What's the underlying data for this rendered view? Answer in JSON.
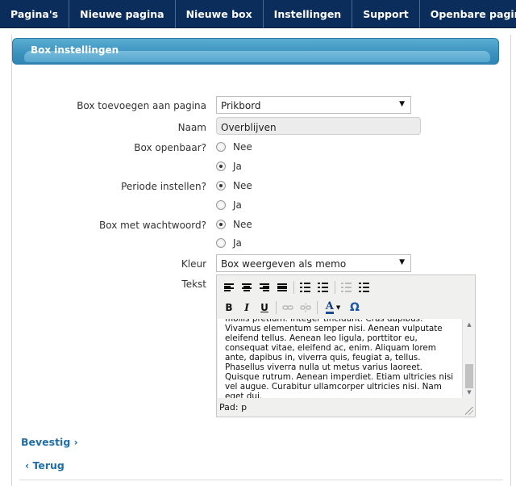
{
  "nav": {
    "items": [
      "Pagina's",
      "Nieuwe pagina",
      "Nieuwe box",
      "Instellingen",
      "Support",
      "Openbare pagina"
    ]
  },
  "panel": {
    "title": "Box instellingen"
  },
  "form": {
    "page_label": "Box toevoegen aan pagina",
    "page_value": "Prikbord",
    "name_label": "Naam",
    "name_value": "Overblijven",
    "public_label": "Box openbaar?",
    "public_options": [
      "Nee",
      "Ja"
    ],
    "public_selected": "Ja",
    "period_label": "Periode instellen?",
    "period_options": [
      "Nee",
      "Ja"
    ],
    "period_selected": "Nee",
    "password_label": "Box met wachtwoord?",
    "password_options": [
      "Nee",
      "Ja"
    ],
    "password_selected": "Nee",
    "color_label": "Kleur",
    "color_value": "Box weergeven als memo",
    "text_label": "Tekst"
  },
  "editor": {
    "text": "mollis pretium. Integer tincidunt. Cras dapibus. Vivamus elementum semper nisi. Aenean vulputate eleifend tellus. Aenean leo ligula, porttitor eu, consequat vitae, eleifend ac, enim. Aliquam lorem ante, dapibus in, viverra quis, feugiat a, tellus. Phasellus viverra nulla ut metus varius laoreet. Quisque rutrum. Aenean imperdiet. Etiam ultricies nisi vel augue. Curabitur ullamcorper ultricies nisi. Nam eget dui.",
    "status": "Pad: p",
    "bold_label": "B",
    "italic_label": "I",
    "underline_label": "U",
    "color_label": "A",
    "omega_label": "Ω"
  },
  "actions": {
    "confirm": "Bevestig",
    "back": "Terug"
  },
  "colors": {
    "nav_bg": "#0a2d5c",
    "header_blue": "#3c93bf",
    "link": "#1f6fa6"
  }
}
